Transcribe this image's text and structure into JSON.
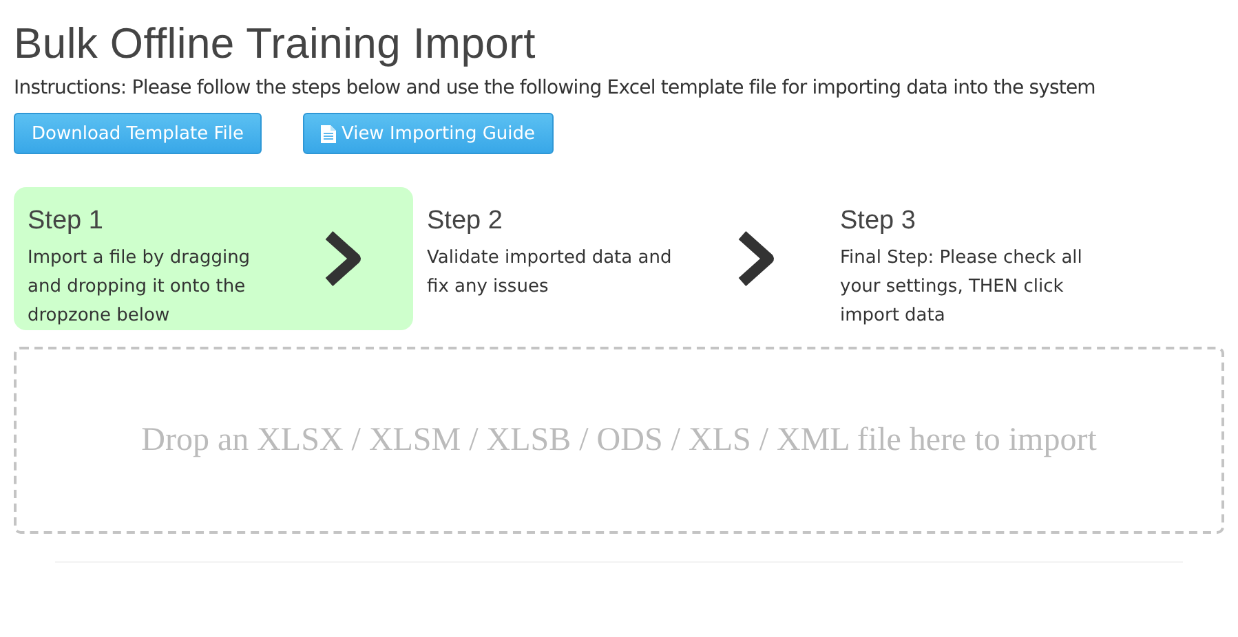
{
  "title": "Bulk Offline Training Import",
  "instructions": "Instructions: Please follow the steps below and use the following Excel template file for importing data into the system",
  "buttons": [
    {
      "label": "Download Template File",
      "kind": "plain"
    },
    {
      "label": "View Importing Guide",
      "kind": "document"
    }
  ],
  "steps": [
    {
      "title": "Step 1",
      "text": "Import a file by dragging and dropping it onto the dropzone below",
      "selected": true
    },
    {
      "title": "Step 2",
      "text": "Validate imported data and fix any issues",
      "selected": false
    },
    {
      "title": "Step 3",
      "text": "Final Step: Please check all your settings, THEN click import data",
      "selected": false
    }
  ],
  "dropzone": {
    "text": "Drop an XLSX / XLSM / XLSB / ODS / XLS / XML file here to import"
  }
}
